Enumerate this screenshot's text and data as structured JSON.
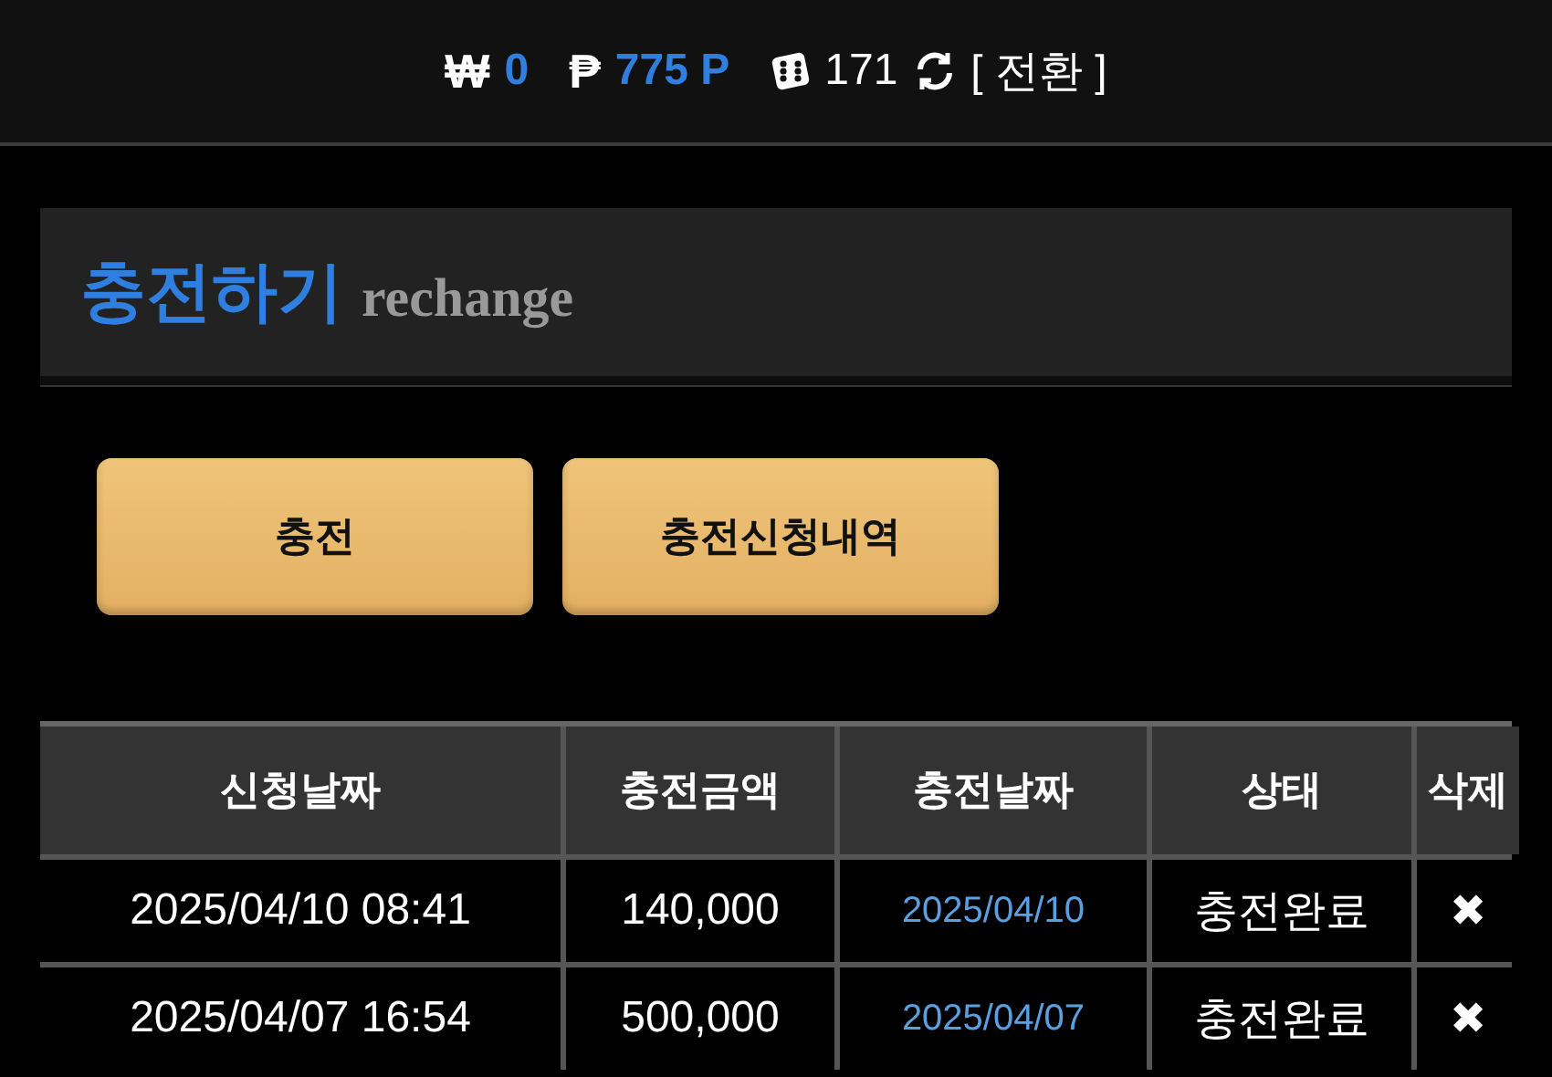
{
  "balance": {
    "won_symbol": "₩",
    "won": "0",
    "point_symbol": "₱",
    "points": "775 P",
    "chips": "171",
    "switch": "[ 전환 ]"
  },
  "section": {
    "title": "충전하기",
    "subtitle": "rechange"
  },
  "buttons": [
    "충전",
    "충전신청내역"
  ],
  "table": {
    "columns": [
      "신청날짜",
      "충전금액",
      "충전날짜",
      "상태",
      "삭제"
    ],
    "rows": [
      {
        "requested": "2025/04/10 08:41",
        "amount": "140,000",
        "charged": "2025/04/10",
        "status": "충전완료",
        "delete": "✖"
      },
      {
        "requested": "2025/04/07 16:54",
        "amount": "500,000",
        "charged": "2025/04/07",
        "status": "충전완료",
        "delete": "✖"
      }
    ]
  }
}
